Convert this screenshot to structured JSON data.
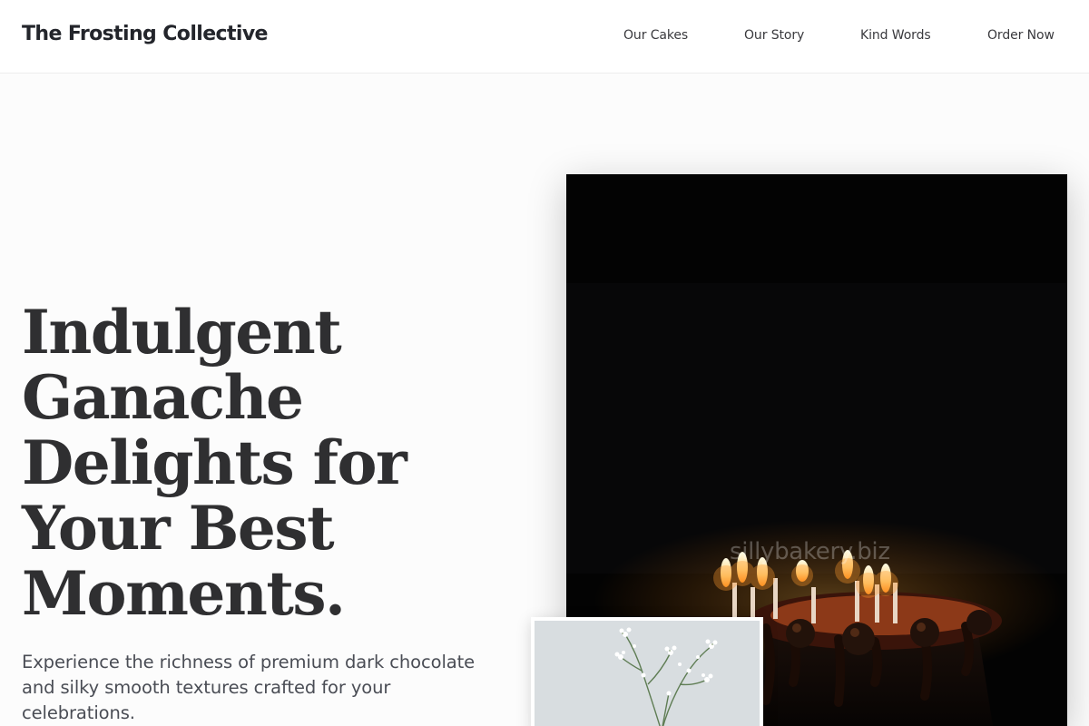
{
  "header": {
    "brand": "The Frosting Collective",
    "nav": [
      "Our Cakes",
      "Our Story",
      "Kind Words",
      "Order Now"
    ]
  },
  "hero": {
    "title_lines": [
      "Indulgent",
      "Ganache",
      "Delights for",
      "Your Best",
      "Moments."
    ],
    "subtitle": "Experience the richness of premium dark chocolate and silky smooth textures crafted for your celebrations."
  },
  "images": {
    "main_watermark": "sillybakery.biz",
    "main_subject": "chocolate-ganache-cake-with-lit-candles",
    "secondary_subject": "white-babys-breath-flowers"
  },
  "colors": {
    "heading": "#2f2f31",
    "body_text": "#4a4d55",
    "page_background": "#fcfcfc"
  }
}
